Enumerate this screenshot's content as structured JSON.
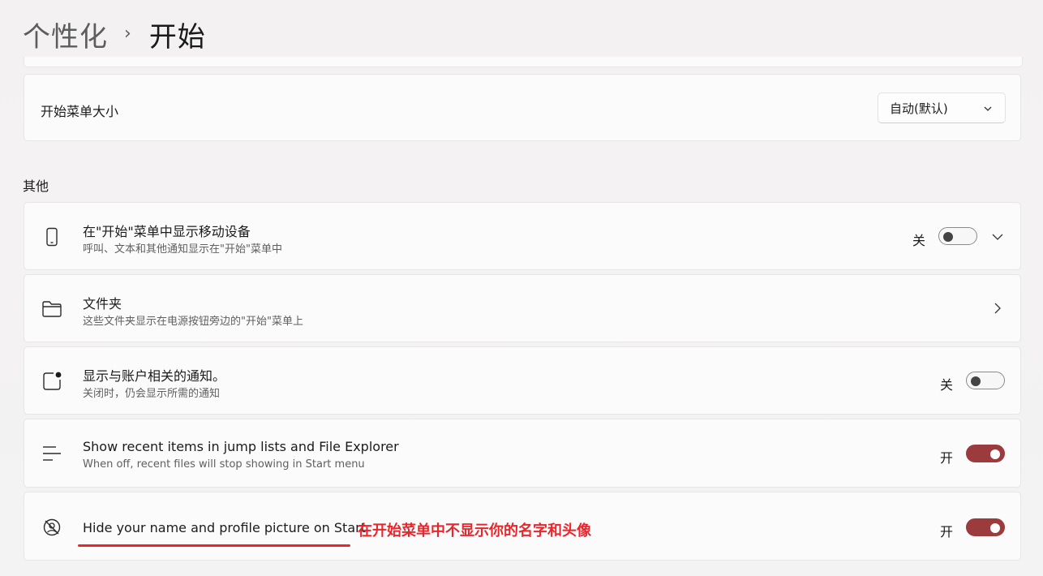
{
  "breadcrumb": {
    "parent": "个性化",
    "separator": "›",
    "current": "开始"
  },
  "start_menu_size": {
    "title": "开始菜单大小",
    "dropdown_value": "自动(默认)"
  },
  "section_other": {
    "label": "其他"
  },
  "rows": [
    {
      "icon": "phone-icon",
      "title": "在\"开始\"菜单中显示移动设备",
      "subtitle": "呼叫、文本和其他通知显示在\"开始\"菜单中",
      "state_label": "关",
      "toggle_on": false
    },
    {
      "icon": "folder-icon",
      "title": "文件夹",
      "subtitle": "这些文件夹显示在电源按钮旁边的\"开始\"菜单上"
    },
    {
      "icon": "notification-badge-icon",
      "title": "显示与账户相关的通知。",
      "subtitle": "关闭时，仍会显示所需的通知",
      "state_label": "关",
      "toggle_on": false
    },
    {
      "icon": "list-icon",
      "title": "Show recent items in jump lists and File Explorer",
      "subtitle": "When off, recent files will stop showing in Start menu",
      "state_label": "开",
      "toggle_on": true
    },
    {
      "icon": "hidden-profile-icon",
      "title": "Hide your name and profile picture on Start",
      "annotation": "在开始菜单中不显示你的名字和头像",
      "state_label": "开",
      "toggle_on": true
    }
  ],
  "colors": {
    "toggle_on": "#9b3b3d",
    "annotation": "#e8262b"
  }
}
